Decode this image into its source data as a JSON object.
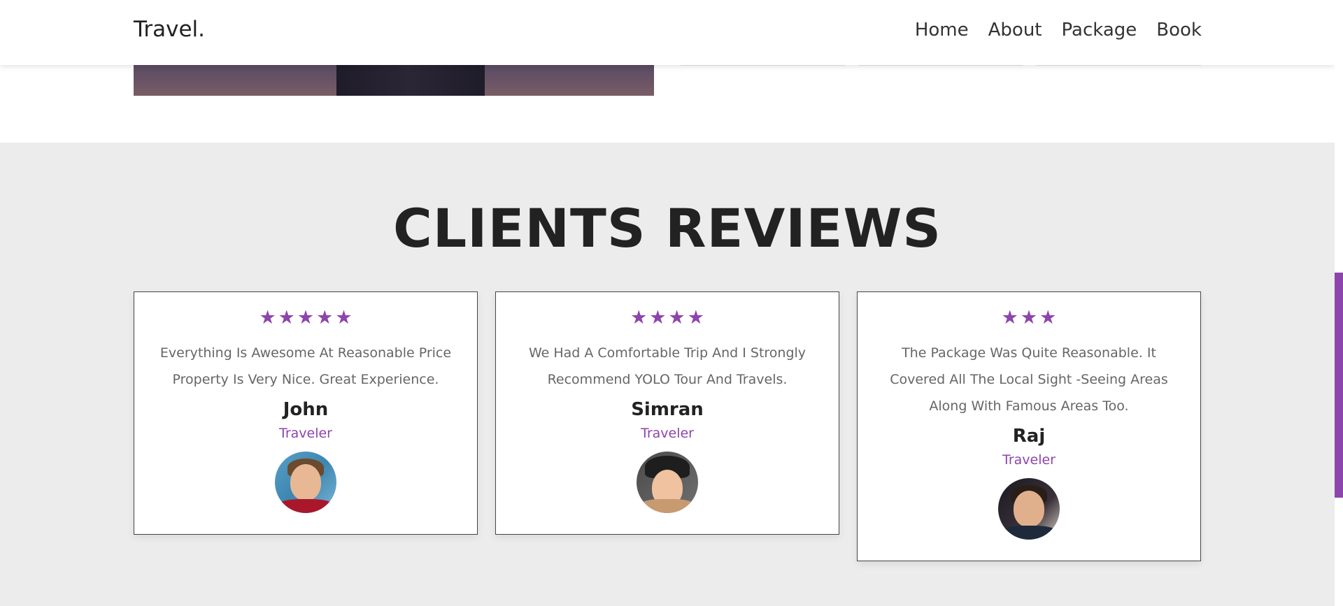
{
  "nav": {
    "brand": "Travel.",
    "links": [
      "Home",
      "About",
      "Package",
      "Book"
    ]
  },
  "reviews": {
    "title": "CLIENTS REVIEWS",
    "accent_color": "#8e44ad",
    "cards": [
      {
        "stars": 5,
        "text": "Everything Is Awesome At Reasonable Price Property Is Very Nice. Great Experience.",
        "name": "John",
        "role": "Traveler",
        "avatar_icon": "man-avatar-icon"
      },
      {
        "stars": 4,
        "text": "We Had A Comfortable Trip And I Strongly Recommend YOLO Tour And Travels.",
        "name": "Simran",
        "role": "Traveler",
        "avatar_icon": "woman-avatar-icon"
      },
      {
        "stars": 3,
        "text": "The Package Was Quite Reasonable. It Covered All The Local Sight -Seeing Areas Along With Famous Areas Too.",
        "name": "Raj",
        "role": "Traveler",
        "avatar_icon": "man-avatar-icon"
      }
    ]
  }
}
